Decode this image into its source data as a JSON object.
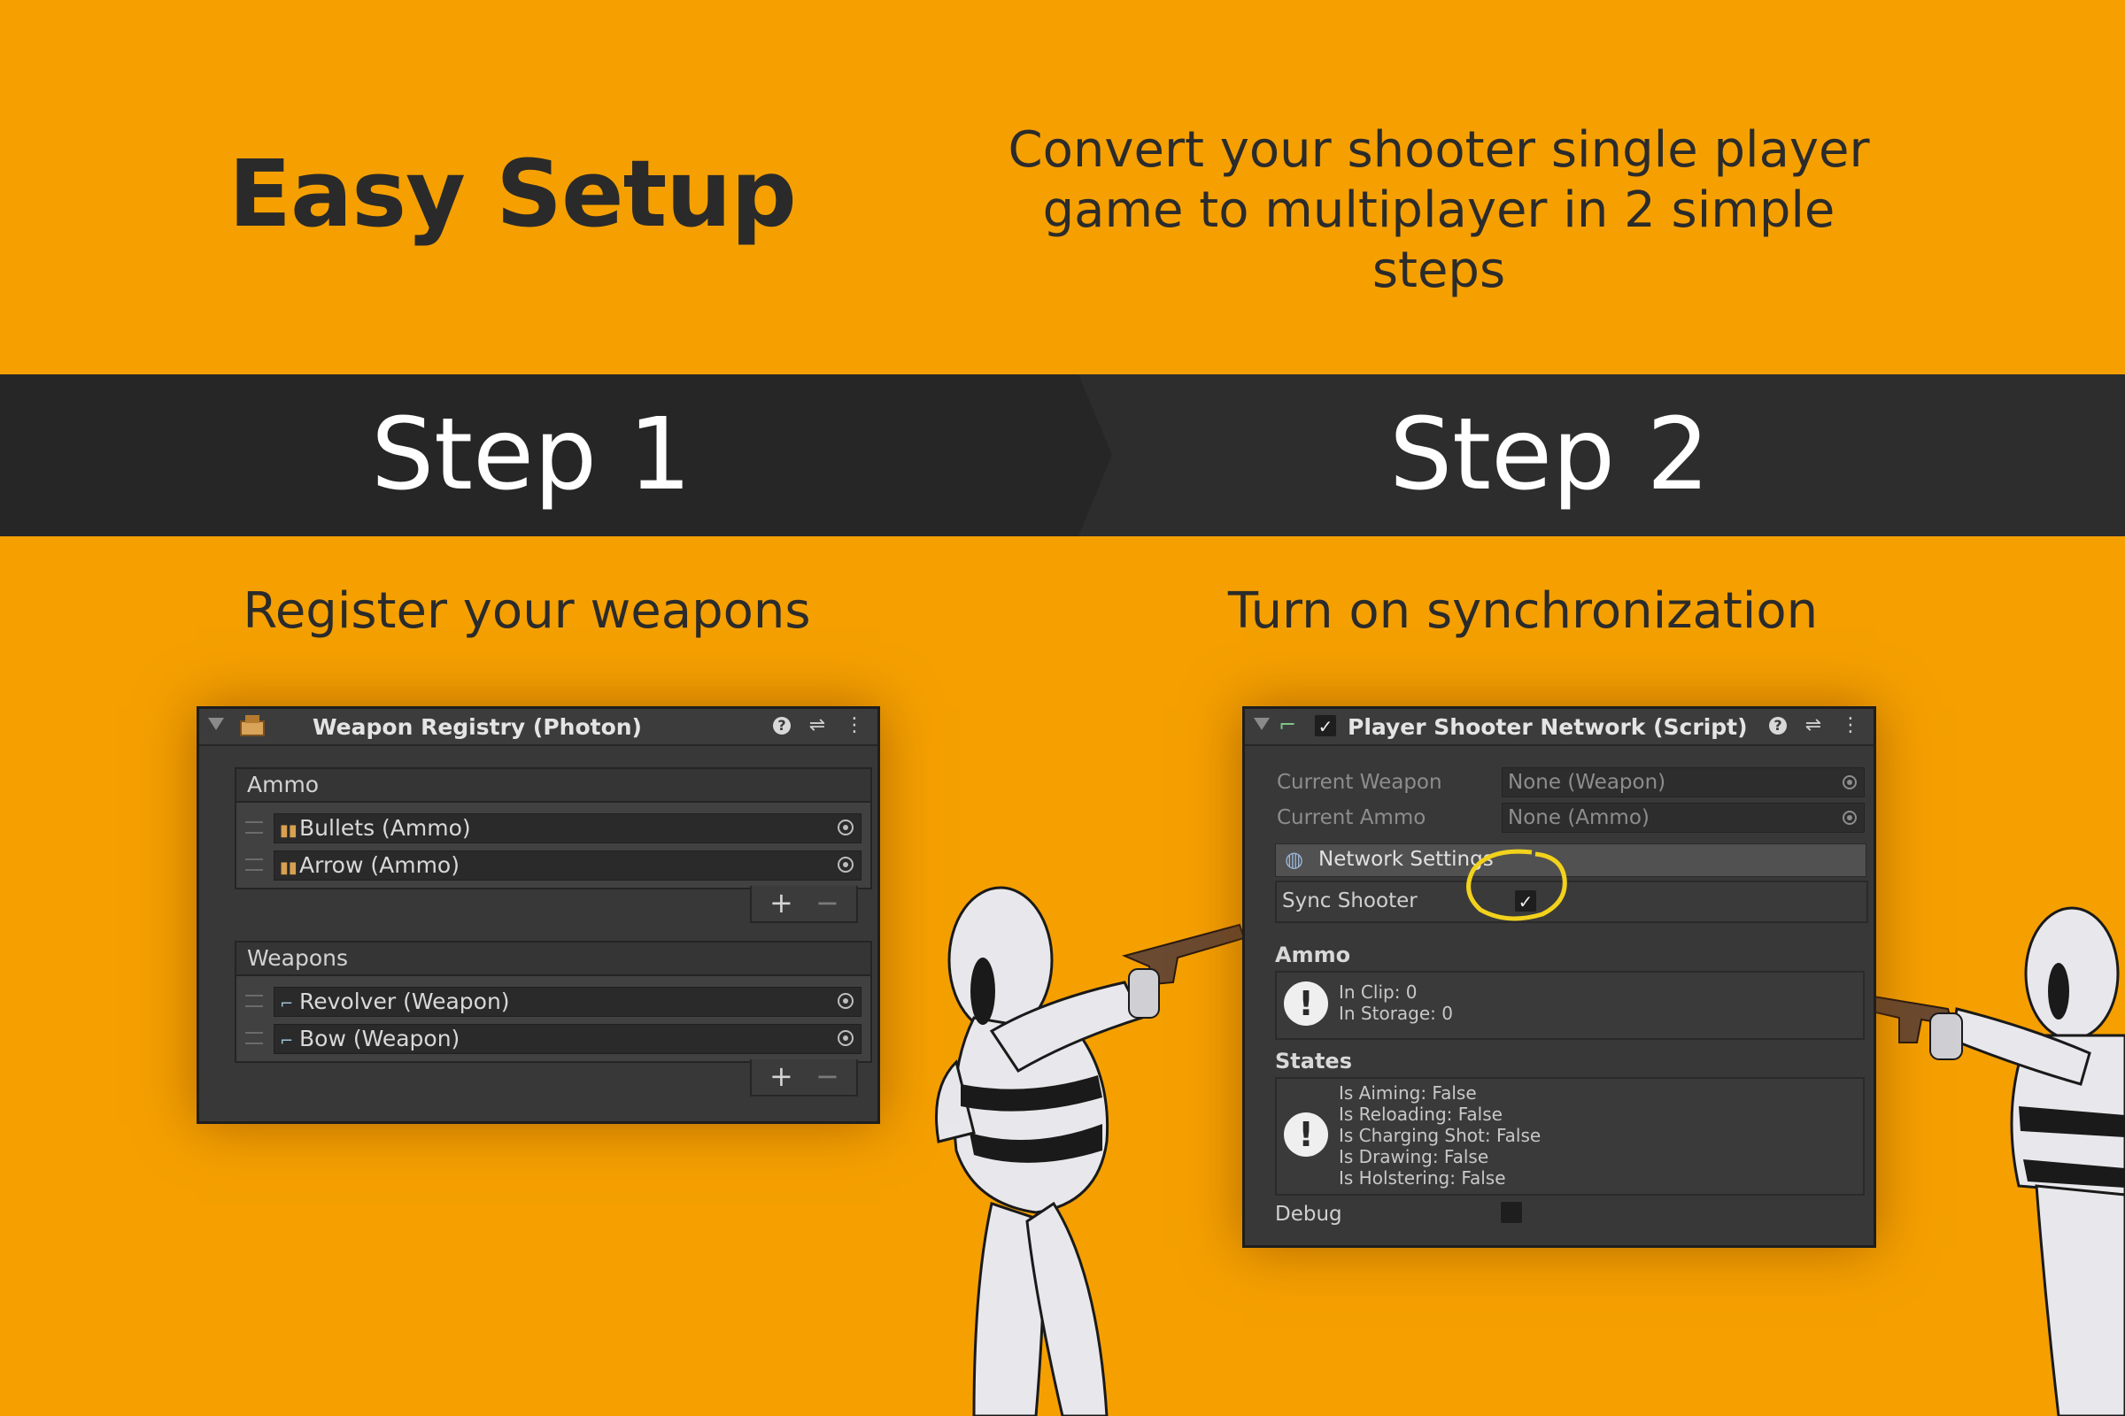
{
  "header": {
    "title": "Easy Setup",
    "subtitle_line1": "Convert your shooter single player",
    "subtitle_line2": "game to multiplayer in 2 simple steps"
  },
  "banner": {
    "step1": "Step 1",
    "step2": "Step 2"
  },
  "sections": {
    "step1_caption": "Register your weapons",
    "step2_caption": "Turn on synchronization"
  },
  "weapon_registry": {
    "title": "Weapon Registry (Photon)",
    "ammo_header": "Ammo",
    "ammo_items": [
      "Bullets (Ammo)",
      "Arrow (Ammo)"
    ],
    "weapons_header": "Weapons",
    "weapon_items": [
      "Revolver (Weapon)",
      "Bow (Weapon)"
    ],
    "add_symbol": "+",
    "remove_symbol": "−"
  },
  "network_component": {
    "title": "Player Shooter Network (Script)",
    "enabled": true,
    "current_weapon_label": "Current Weapon",
    "current_weapon_value": "None (Weapon)",
    "current_ammo_label": "Current Ammo",
    "current_ammo_value": "None (Ammo)",
    "network_settings_label": "Network Settings",
    "sync_shooter_label": "Sync Shooter",
    "sync_shooter_checked": true,
    "ammo_header": "Ammo",
    "ammo_info": [
      "In Clip: 0",
      "In Storage: 0"
    ],
    "states_header": "States",
    "states_info": [
      "Is Aiming: False",
      "Is Reloading: False",
      "Is Charging Shot: False",
      "Is Drawing: False",
      "Is Holstering: False"
    ],
    "debug_label": "Debug",
    "debug_checked": false
  },
  "colors": {
    "background": "#f5a000",
    "banner": "#262626",
    "banner_right": "#2d2d2d",
    "highlight_circle": "#f2d21c"
  },
  "icons": [
    "help-icon",
    "preset-icon",
    "kebab-menu-icon",
    "object-picker-icon",
    "drag-handle-icon",
    "checkmark-icon",
    "info-icon"
  ]
}
